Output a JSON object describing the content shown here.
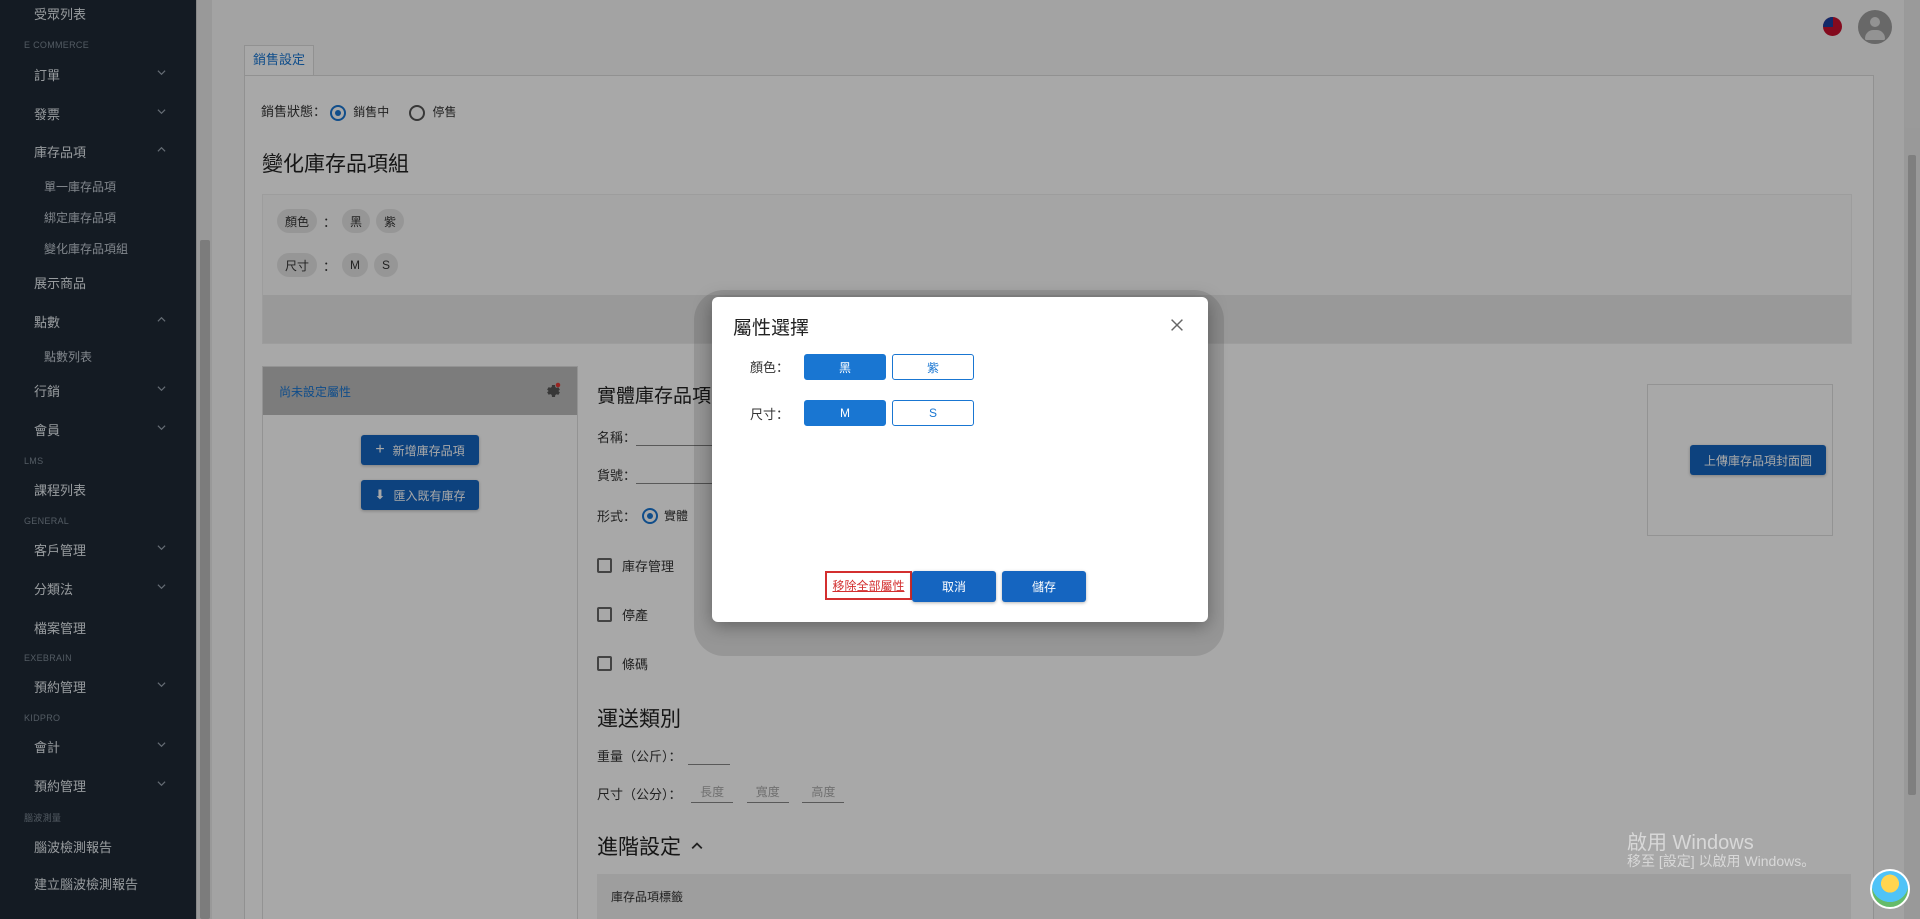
{
  "sidebar": {
    "items": [
      {
        "label": "受眾列表"
      },
      {
        "section": "E COMMERCE"
      },
      {
        "label": "訂單"
      },
      {
        "label": "發票"
      },
      {
        "label": "庫存品項"
      },
      {
        "sub": "單一庫存品項"
      },
      {
        "sub": "綁定庫存品項"
      },
      {
        "sub": "變化庫存品項組"
      },
      {
        "label": "展示商品"
      },
      {
        "label": "點數"
      },
      {
        "sub": "點數列表"
      },
      {
        "label": "行銷"
      },
      {
        "label": "會員"
      },
      {
        "section": "LMS"
      },
      {
        "label": "課程列表"
      },
      {
        "section": "GENERAL"
      },
      {
        "label": "客戶管理"
      },
      {
        "label": "分類法"
      },
      {
        "label": "檔案管理"
      },
      {
        "section": "EXEBRAIN"
      },
      {
        "label": "預約管理"
      },
      {
        "section": "KIDPRO"
      },
      {
        "label": "會計"
      },
      {
        "label": "預約管理"
      },
      {
        "section": "腦波測量"
      },
      {
        "label": "腦波檢測報告"
      },
      {
        "label": "建立腦波檢測報告"
      }
    ]
  },
  "page": {
    "tab_label": "銷售設定",
    "sales_status_label": "銷售狀態：",
    "sales_on": "銷售中",
    "sales_off": "停售",
    "variant_group_title": "變化庫存品項組",
    "attr_color_label": "顏色",
    "attr_size_label": "尺寸",
    "colon": "：",
    "color_values": [
      "黑",
      "紫"
    ],
    "size_values": [
      "M",
      "S"
    ],
    "left_panel_header": "尚未設定屬性",
    "add_item_button": "新增庫存品項",
    "import_button": "匯入既有庫存",
    "physical_title": "實體庫存品項",
    "name_label": "名稱：",
    "sku_label": "貨號：",
    "form_label": "形式：",
    "form_physical": "實體",
    "inventory_mgmt": "庫存管理",
    "discontinued": "停產",
    "barcode": "條碼",
    "shipping_title": "運送類別",
    "weight_label": "重量（公斤）：",
    "dimension_label": "尺寸（公分）：",
    "length_ph": "長度",
    "width_ph": "寬度",
    "height_ph": "高度",
    "advanced_title": "進階設定",
    "tag_header": "庫存品項標籤",
    "upload_cover_button": "上傳庫存品項封面圖"
  },
  "dialog": {
    "title": "屬性選擇",
    "color_label": "顏色：",
    "size_label": "尺寸：",
    "color_options": [
      {
        "label": "黑",
        "selected": true
      },
      {
        "label": "紫",
        "selected": false
      }
    ],
    "size_options": [
      {
        "label": "M",
        "selected": true
      },
      {
        "label": "S",
        "selected": false
      }
    ],
    "remove_all": "移除全部屬性",
    "cancel": "取消",
    "save": "儲存"
  },
  "watermark": {
    "line1": "啟用 Windows",
    "line2": "移至 [設定] 以啟用 Windows。"
  },
  "colors": {
    "sidebar_bg": "#1f2a36",
    "accent": "#1976d2",
    "danger": "#d32f2f"
  }
}
